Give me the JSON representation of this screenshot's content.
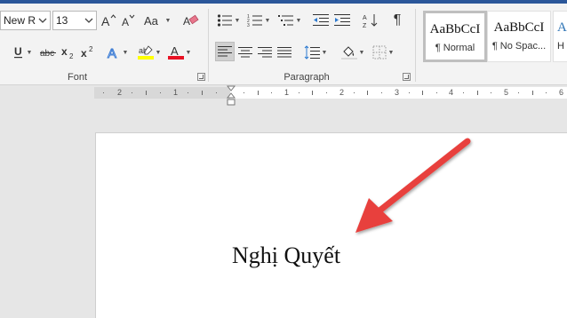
{
  "font": {
    "name_value": "Times New Roman",
    "name_visible": "New R",
    "size_value": "13",
    "group_label": "Font"
  },
  "paragraph": {
    "group_label": "Paragraph"
  },
  "styles": {
    "items": [
      {
        "sample": "AaBbCcI",
        "name": "¶ Normal"
      },
      {
        "sample": "AaBbCcI",
        "name": "¶ No Spac..."
      },
      {
        "sample": "A",
        "name": "H"
      }
    ]
  },
  "ruler": {
    "labels": [
      "2",
      "1",
      "1",
      "2",
      "3",
      "4",
      "5",
      "6"
    ]
  },
  "document": {
    "text": "Nghị Quyết"
  },
  "colors": {
    "accent": "#2b579a",
    "highlight": "#ffff00",
    "font_color": "#e81123",
    "arrow": "#e8403c"
  }
}
